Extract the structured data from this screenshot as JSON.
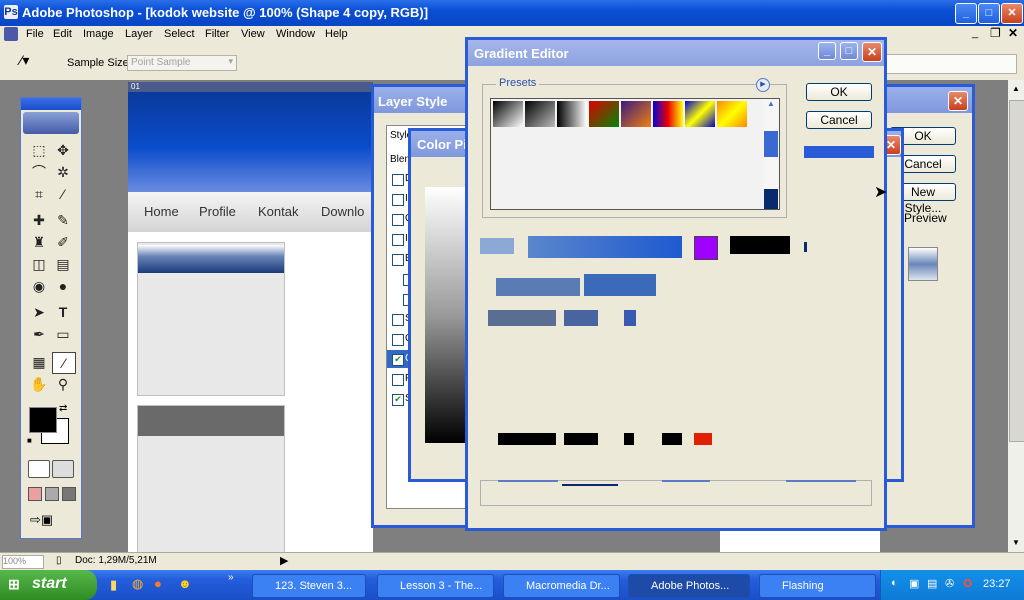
{
  "app": {
    "title": "Adobe Photoshop - [kodok website @ 100% (Shape 4 copy, RGB)]",
    "win_min": "_",
    "win_max": "□",
    "win_close": "✕"
  },
  "menu": [
    "File",
    "Edit",
    "Image",
    "Layer",
    "Select",
    "Filter",
    "View",
    "Window",
    "Help"
  ],
  "options": {
    "sample_size_label": "Sample Size:",
    "sample_size_value": "Point Sample"
  },
  "document": {
    "tab_label": "01",
    "nav": [
      "Home",
      "Profile",
      "Kontak",
      "Downlo"
    ]
  },
  "layer_style": {
    "title": "Layer Style",
    "styles_header": "Style",
    "blend_label": "Blend",
    "ok": "OK",
    "cancel": "Cancel",
    "new_style": "New Style...",
    "preview": "Preview",
    "items": [
      "D",
      "In",
      "O",
      "In",
      "B",
      "C",
      "S",
      "C",
      "G",
      "P",
      "S"
    ]
  },
  "color_picker": {
    "title": "Color Pi"
  },
  "gradient_editor": {
    "title": "Gradient Editor",
    "presets_label": "Presets",
    "ok": "OK",
    "cancel": "Cancel"
  },
  "status": {
    "zoom": "100%",
    "doc": "Doc: 1,29M/5,21M"
  },
  "taskbar": {
    "start": "start",
    "tasks": [
      "123. Steven 3...",
      "Lesson 3 - The...",
      "Macromedia Dr...",
      "Adobe Photos...",
      "Flashing"
    ],
    "clock": "23:27"
  },
  "colors": {
    "xp_blue": "#0a4fd6",
    "dialog_border": "#2a5bd7",
    "swatch_violet": "#a000ff",
    "swatch_red": "#e02000"
  }
}
